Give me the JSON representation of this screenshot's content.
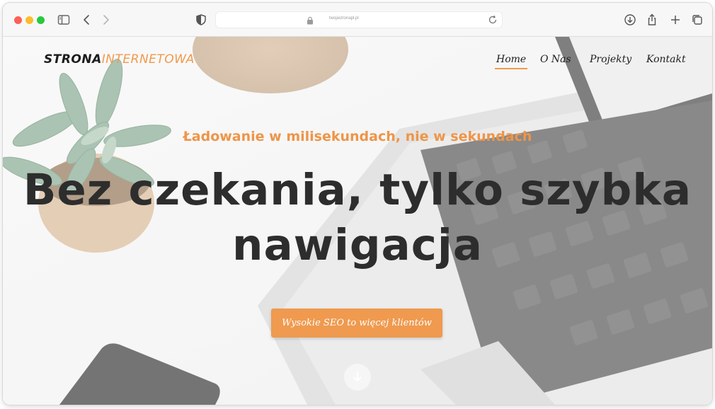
{
  "browser": {
    "url": "twojastronapl.pl",
    "icons": {
      "sidebar": "sidebar-icon",
      "back": "chevron-left-icon",
      "forward": "chevron-right-icon",
      "privacy": "shield-icon",
      "lock": "lock-icon",
      "reload": "reload-icon",
      "download": "download-icon",
      "share": "share-icon",
      "new_tab": "plus-icon",
      "tabs": "tabs-icon"
    }
  },
  "site": {
    "logo_part1": "STRONA",
    "logo_part2": "INTERNETOWA",
    "nav": [
      {
        "label": "Home",
        "active": true
      },
      {
        "label": "O Nas",
        "active": false
      },
      {
        "label": "Projekty",
        "active": false
      },
      {
        "label": "Kontakt",
        "active": false
      }
    ],
    "subheading": "Ładowanie w milisekundach, nie w sekundach",
    "headline_line1": "Bez czekania, tylko szybka",
    "headline_line2": "nawigacja",
    "cta_label": "Wysokie SEO to więcej klientów",
    "scroll_icon": "arrow-down-icon"
  },
  "colors": {
    "accent": "#f09a4e",
    "headline": "#2d2d2d"
  }
}
